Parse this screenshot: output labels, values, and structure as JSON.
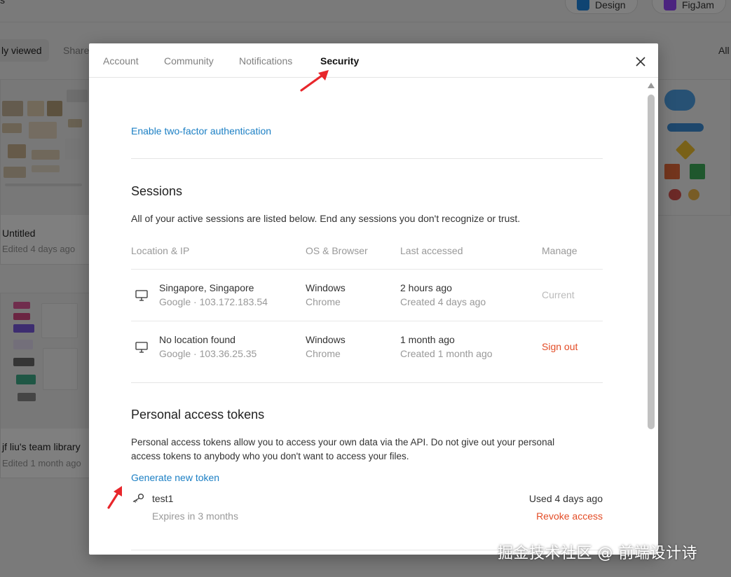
{
  "background": {
    "top_fragment": "s",
    "pill_design": "Design",
    "pill_figjam": "FigJam",
    "tab_recent": "ly viewed",
    "tab_shared": "Share",
    "all_label": "All",
    "card1_title": "Untitled",
    "card1_sub": "Edited 4 days ago",
    "card2_title": "jf liu's team library",
    "card2_sub": "Edited 1 month ago"
  },
  "tabs": {
    "account": "Account",
    "community": "Community",
    "notifications": "Notifications",
    "security": "Security"
  },
  "security": {
    "two_factor_link": "Enable two-factor authentication",
    "sessions_title": "Sessions",
    "sessions_desc": "All of your active sessions are listed below. End any sessions you don't recognize or trust.",
    "columns": {
      "location": "Location & IP",
      "os": "OS & Browser",
      "last": "Last accessed",
      "manage": "Manage"
    },
    "sessions": [
      {
        "location": "Singapore, Singapore",
        "ip": "Google · 103.172.183.54",
        "os": "Windows",
        "browser": "Chrome",
        "last": "2 hours ago",
        "created": "Created 4 days ago",
        "manage": "Current"
      },
      {
        "location": "No location found",
        "ip": "Google · 103.36.25.35",
        "os": "Windows",
        "browser": "Chrome",
        "last": "1 month ago",
        "created": "Created 1 month ago",
        "manage": "Sign out"
      }
    ],
    "tokens_title": "Personal access tokens",
    "tokens_desc_1": "Personal access tokens allow you to access your own data via the API. Do not give out your personal",
    "tokens_desc_2": "access tokens to anybody who you don't want to access your files.",
    "generate_link": "Generate new token",
    "token": {
      "name": "test1",
      "expires": "Expires in 3 months",
      "used": "Used 4 days ago",
      "revoke": "Revoke access"
    }
  },
  "colors": {
    "link": "#1b7fc4",
    "danger": "#e34c26",
    "annotation_arrow": "#e8262b"
  },
  "watermark": "掘金技术社区 @ 前端设计诗"
}
